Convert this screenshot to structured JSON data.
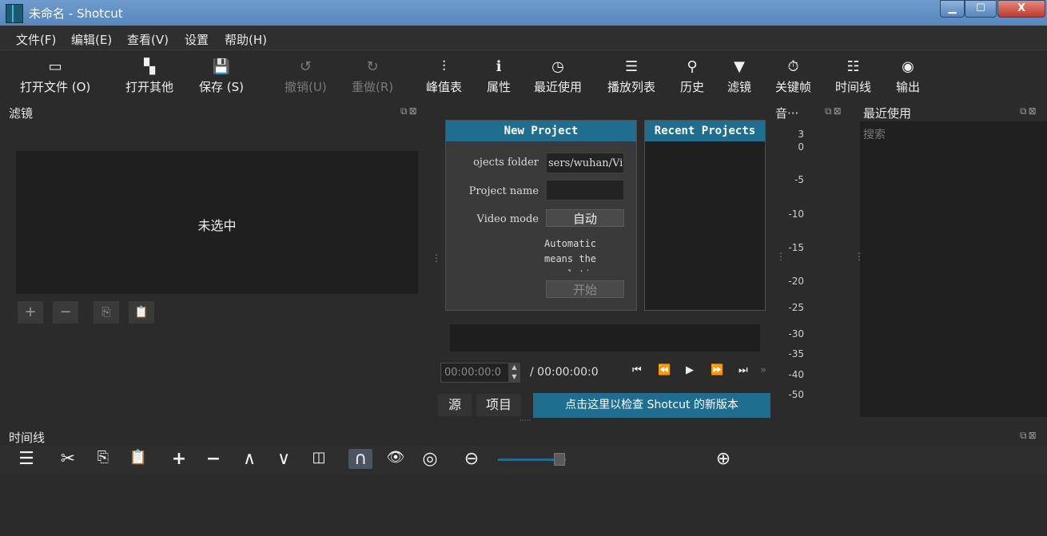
{
  "window": {
    "title": "未命名 - Shotcut",
    "controls": {
      "minimize": "▁",
      "maximize": "☐",
      "close": "X"
    }
  },
  "menu": [
    "文件(F)",
    "编辑(E)",
    "查看(V)",
    "设置",
    "帮助(H)"
  ],
  "toolbar": [
    {
      "label": "打开文件 (O)",
      "icon": "folder-icon",
      "glyph": "▭",
      "enabled": true
    },
    {
      "label": "打开其他",
      "icon": "open-other-icon",
      "glyph": "▚",
      "enabled": true
    },
    {
      "label": "保存 (S)",
      "icon": "save-icon",
      "glyph": "💾",
      "enabled": true
    },
    {
      "label": "撤销(U)",
      "icon": "undo-icon",
      "glyph": "↺",
      "enabled": false
    },
    {
      "label": "重做(R)",
      "icon": "redo-icon",
      "glyph": "↻",
      "enabled": false
    },
    {
      "label": "峰值表",
      "icon": "peak-meter-icon",
      "glyph": "⫶",
      "enabled": true
    },
    {
      "label": "属性",
      "icon": "properties-icon",
      "glyph": "ℹ",
      "enabled": true
    },
    {
      "label": "最近使用",
      "icon": "recent-icon",
      "glyph": "◷",
      "enabled": true
    },
    {
      "label": "播放列表",
      "icon": "playlist-icon",
      "glyph": "☰",
      "enabled": true
    },
    {
      "label": "历史",
      "icon": "history-icon",
      "glyph": "⚲",
      "enabled": true
    },
    {
      "label": "滤镜",
      "icon": "filter-icon",
      "glyph": "▼",
      "enabled": true
    },
    {
      "label": "关键帧",
      "icon": "keyframes-icon",
      "glyph": "⏱",
      "enabled": true
    },
    {
      "label": "时间线",
      "icon": "timeline-icon",
      "glyph": "☷",
      "enabled": true
    },
    {
      "label": "输出",
      "icon": "export-icon",
      "glyph": "◉",
      "enabled": true
    }
  ],
  "filters_panel": {
    "title": "滤镜",
    "float_icons": "⧉⊠",
    "empty_text": "未选中",
    "buttons": [
      {
        "name": "add-filter-button",
        "glyph": "+"
      },
      {
        "name": "remove-filter-button",
        "glyph": "−"
      },
      {
        "name": "copy-filter-button",
        "glyph": "⎘"
      },
      {
        "name": "paste-filter-button",
        "glyph": "📋"
      }
    ]
  },
  "new_project": {
    "header": "New Project",
    "folder_label": "ojects folder",
    "folder_value": "sers/wuhan/Vi",
    "name_label": "Project name",
    "name_value": "",
    "video_mode_label": "Video mode",
    "video_mode_value": "自动",
    "description": "Automatic means the resolution",
    "start_button": "开始"
  },
  "recent_projects": {
    "header": "Recent Projects"
  },
  "player": {
    "timecode": "00:00:00:0",
    "duration": "/ 00:00:00:0",
    "controls": [
      {
        "name": "skip-to-start-icon",
        "glyph": "⏮"
      },
      {
        "name": "rewind-icon",
        "glyph": "⏪"
      },
      {
        "name": "play-icon",
        "glyph": "▶"
      },
      {
        "name": "fast-forward-icon",
        "glyph": "⏩"
      },
      {
        "name": "skip-to-end-icon",
        "glyph": "⏭"
      },
      {
        "name": "more-icon",
        "glyph": "»"
      }
    ],
    "tabs": [
      "源",
      "项目"
    ],
    "update_banner": "点击这里以检查 Shotcut 的新版本"
  },
  "audio_meter": {
    "title": "音···",
    "float_icons": "⧉⊠",
    "scale": [
      "3",
      "0",
      "-5",
      "-10",
      "-15",
      "-20",
      "-25",
      "-30",
      "-35",
      "-40",
      "-50"
    ]
  },
  "recent_panel": {
    "title": "最近使用",
    "float_icons": "⧉⊠",
    "search_placeholder": "搜索"
  },
  "timeline": {
    "title": "时间线",
    "float_icons": "⧉⊠",
    "zoom_level": 0.9
  }
}
